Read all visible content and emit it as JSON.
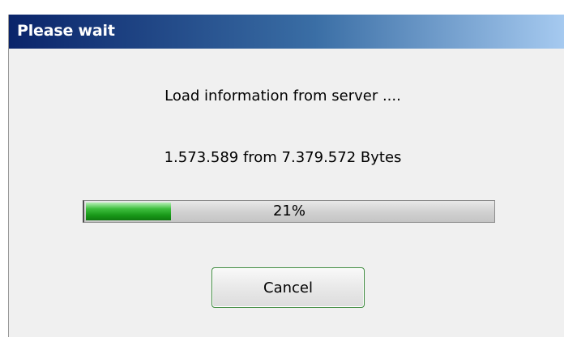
{
  "window": {
    "title": "Please wait"
  },
  "dialog": {
    "message": "Load information from server ....",
    "bytes_status": "1.573.589 from 7.379.572 Bytes"
  },
  "progress": {
    "percent": 21,
    "label": "21%",
    "fill_color": "#1a9a1a"
  },
  "buttons": {
    "cancel_label": "Cancel"
  }
}
